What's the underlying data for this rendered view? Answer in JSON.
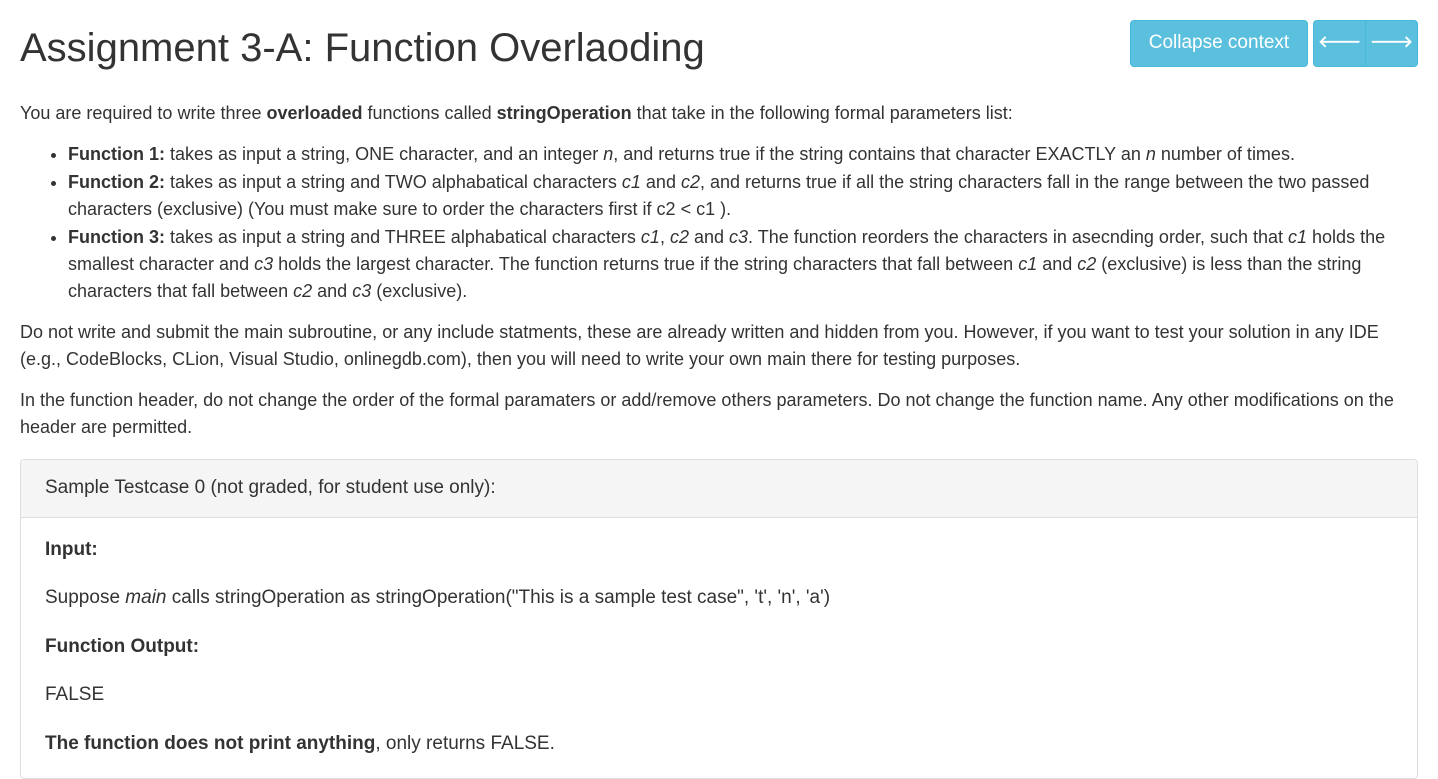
{
  "header": {
    "title": "Assignment 3-A: Function Overlaoding",
    "collapse_label": "Collapse context"
  },
  "intro": {
    "p1_a": "You are required to write three ",
    "p1_b": "overloaded",
    "p1_c": " functions called ",
    "p1_d": "stringOperation",
    "p1_e": " that take in the following formal parameters list:"
  },
  "functions": {
    "f1_label": "Function 1:",
    "f1_a": " takes as input a string, ONE character, and an integer ",
    "f1_n1": "n",
    "f1_b": ", and returns true if the string contains that character EXACTLY an ",
    "f1_n2": "n",
    "f1_c": " number of times.",
    "f2_label": "Function 2:",
    "f2_a": " takes as input a string and TWO alphabatical characters ",
    "f2_c1": "c1",
    "f2_b": " and ",
    "f2_c2": "c2",
    "f2_c": ", and returns true if all the string characters fall in the range between the two passed characters (exclusive) (You must make sure to order the characters first if c2 < c1 ).",
    "f3_label": "Function 3:",
    "f3_a": " takes as input a string and THREE alphabatical characters ",
    "f3_c1": "c1",
    "f3_b": ", ",
    "f3_c2": "c2",
    "f3_c": " and ",
    "f3_c3": "c3",
    "f3_d": ". The function reorders the characters in asecnding order, such that ",
    "f3_c1b": "c1",
    "f3_e": " holds the smallest character and ",
    "f3_c3b": "c3",
    "f3_f": " holds the largest character. The function returns true if the string characters that fall between ",
    "f3_c1c": "c1",
    "f3_g": " and ",
    "f3_c2b": "c2",
    "f3_h": " (exclusive) is less than the string characters that fall between ",
    "f3_c2c": "c2",
    "f3_i": " and ",
    "f3_c3c": "c3",
    "f3_j": " (exclusive)."
  },
  "notes": {
    "p2": "Do not write and submit the main subroutine, or any include statments, these are already written and hidden from you. However, if you want to test your solution in any IDE (e.g., CodeBlocks, CLion, Visual Studio, onlinegdb.com), then you will need to write your own main there for testing purposes.",
    "p3": "In the function header, do not change the order of the formal paramaters or add/remove others parameters. Do not change the function name. Any other modifications on the header are permitted."
  },
  "testcase": {
    "heading": "Sample Testcase 0 (not graded, for student use only):",
    "input_label": "Input:",
    "input_a": "Suppose ",
    "input_main": "main",
    "input_b": " calls stringOperation as stringOperation(\"This is a sample test case\", 't', 'n', 'a')",
    "output_label": "Function Output:",
    "output_value": "FALSE",
    "note_bold": "The function does not print anything",
    "note_rest": ", only returns FALSE."
  }
}
